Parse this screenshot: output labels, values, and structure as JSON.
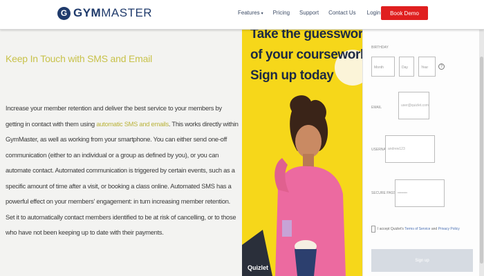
{
  "header": {
    "logo_letter": "G",
    "logo_brand": "GYM",
    "logo_rest": "MASTER",
    "nav": {
      "features": "Features",
      "pricing": "Pricing",
      "support": "Support",
      "contact": "Contact Us",
      "login": "Login"
    },
    "book_demo": "Book Demo"
  },
  "content": {
    "heading": "Keep In Touch with SMS and Email",
    "body_before": "Increase your member retention and deliver the best service to your members by getting in contact with them using ",
    "body_highlight": "automatic SMS and emails",
    "body_after": ". This works directly within GymMaster, as well as working from your smartphone. You can either send one-off communication (either to an individual or a group as defined by you), or you can automate contact. Automated communication is triggered by certain events, such as a specific amount of time after a visit, or booking a class online. Automated SMS has a powerful effect on your members' engagement: in turn increasing member retention. Set it to automatically contact members identified to be at risk of cancelling, or to those who have not been keeping up to date with their payments."
  },
  "ad": {
    "line1": "Take the guesswork out",
    "line2": "of your coursework.",
    "line3": "Sign up today",
    "brand": "Quizlet"
  },
  "form": {
    "birthday_label": "BIRTHDAY",
    "month_placeholder": "Month",
    "day_placeholder": "Day",
    "year_placeholder": "Year",
    "email_label": "EMAIL",
    "email_placeholder": "user@quizlet.com",
    "username_label": "USERNAME",
    "username_placeholder": "andrew123",
    "password_label": "SECURE PASSWORD",
    "password_placeholder": "••••••••",
    "terms_prefix": "I accept Quizlet's ",
    "terms_link": "Terms of Service",
    "terms_and": " and ",
    "privacy_link": "Privacy Policy",
    "signup_label": "Sign up"
  },
  "colors": {
    "accent_red": "#e01f1f",
    "highlight": "#c8c24a",
    "ad_yellow": "#f6d71a",
    "navy": "#1f3a6b"
  }
}
